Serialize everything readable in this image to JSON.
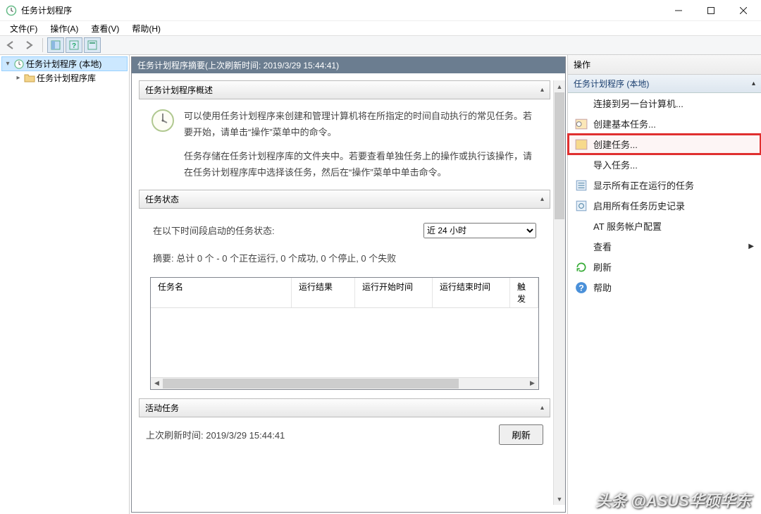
{
  "window": {
    "title": "任务计划程序"
  },
  "menubar": {
    "file": "文件(F)",
    "action": "操作(A)",
    "view": "查看(V)",
    "help": "帮助(H)"
  },
  "tree": {
    "root": "任务计划程序 (本地)",
    "library": "任务计划程序库"
  },
  "summary": {
    "header": "任务计划程序摘要(上次刷新时间: 2019/3/29 15:44:41)",
    "overview_title": "任务计划程序概述",
    "overview_p1": "可以使用任务计划程序来创建和管理计算机将在所指定的时间自动执行的常见任务。若要开始，请单击“操作”菜单中的命令。",
    "overview_p2": "任务存储在任务计划程序库的文件夹中。若要查看单独任务上的操作或执行该操作，请在任务计划程序库中选择该任务，然后在“操作”菜单中单击命令。",
    "status_title": "任务状态",
    "status_period_label": "在以下时间段启动的任务状态:",
    "status_period_value": "近 24 小时",
    "status_summary": "摘要: 总计 0 个 - 0 个正在运行, 0 个成功, 0 个停止, 0 个失败",
    "cols": {
      "name": "任务名",
      "result": "运行结果",
      "start": "运行开始时间",
      "end": "运行结束时间",
      "trigger": "触发"
    },
    "active_title": "活动任务",
    "footer_time": "上次刷新时间: 2019/3/29 15:44:41",
    "refresh_btn": "刷新"
  },
  "actions": {
    "header": "操作",
    "group": "任务计划程序 (本地)",
    "items": {
      "connect": "连接到另一台计算机...",
      "create_basic": "创建基本任务...",
      "create_task": "创建任务...",
      "import": "导入任务...",
      "show_running": "显示所有正在运行的任务",
      "enable_history": "启用所有任务历史记录",
      "at_service": "AT 服务帐户配置",
      "view": "查看",
      "refresh": "刷新",
      "help": "帮助"
    }
  },
  "watermark": "头条 @ASUS华硕华东"
}
